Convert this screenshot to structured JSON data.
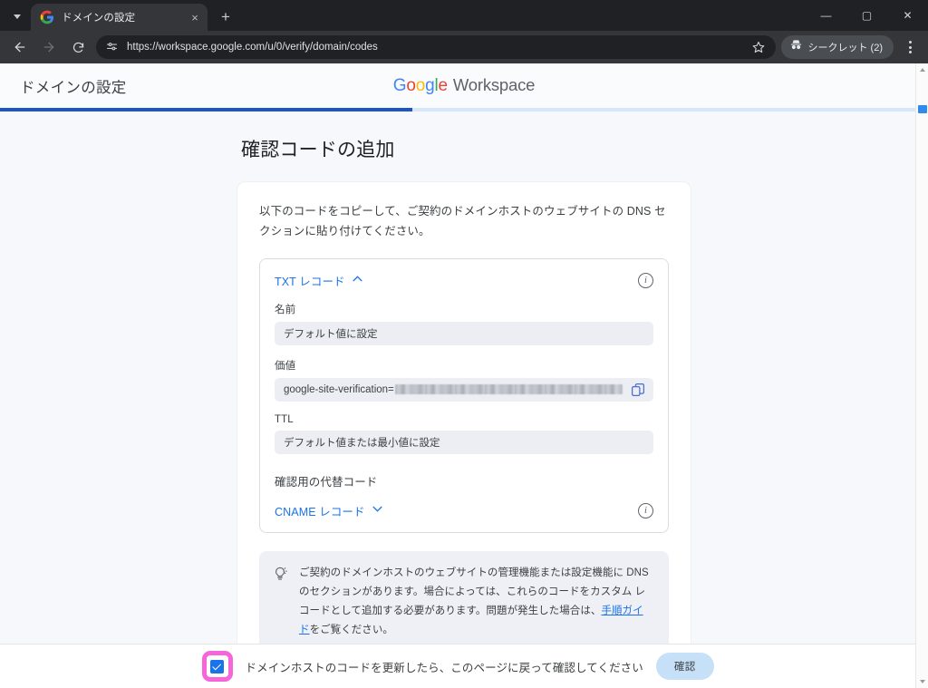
{
  "browser": {
    "tab": {
      "title": "ドメインの設定",
      "favicon": "google-favicon",
      "close_label": "×"
    },
    "tab_search_label": "tab-search",
    "new_tab_label": "+",
    "window_controls": {
      "minimize": "—",
      "maximize": "▢",
      "close": "✕"
    },
    "toolbar": {
      "back_label": "←",
      "forward_label": "→",
      "reload_label": "⟳",
      "url": "https://workspace.google.com/u/0/verify/domain/codes",
      "page_info_icon": "page-settings-icon",
      "bookmark_icon": "star-icon",
      "incognito_label": "シークレット (2)",
      "incognito_icon": "incognito-hat-icon",
      "menu_label": "chrome-menu"
    }
  },
  "page": {
    "header": {
      "title": "ドメインの設定",
      "logo_google": "Google",
      "logo_suffix": "Workspace"
    },
    "progress": {
      "percent": 45
    },
    "heading": "確認コードの追加",
    "instruction": "以下のコードをコピーして、ご契約のドメインホストのウェブサイトの DNS セクションに貼り付けてください。",
    "txt_record": {
      "toggle_label": "TXT レコード",
      "caret": "⌃",
      "info_label": "i",
      "fields": [
        {
          "label": "名前",
          "value": "デフォルト値に設定"
        },
        {
          "label": "価値",
          "value": "google-site-verification=",
          "redacted": true,
          "copy_icon": "copy-icon"
        },
        {
          "label": "TTL",
          "value": "デフォルト値または最小値に設定"
        }
      ]
    },
    "alt_code_heading": "確認用の代替コード",
    "cname_record": {
      "toggle_label": "CNAME レコード",
      "caret": "⌄",
      "info_label": "i"
    },
    "hint": {
      "icon": "lightbulb-icon",
      "text_before": "ご契約のドメインホストのウェブサイトの管理機能または設定機能に DNS のセクションがあります。場合によっては、これらのコードをカスタム レコードとして追加する必要があります。問題が発生した場合は、",
      "link": "手順ガイド",
      "text_after": "をご覧ください。"
    },
    "bottom_bar": {
      "checkbox_checked": true,
      "checkbox_text": "ドメインホストのコードを更新したら、このページに戻って確認してください",
      "verify_button": "確認"
    }
  },
  "colors": {
    "accent_blue": "#1a73e8",
    "progress_fill": "#1a56c4",
    "progress_track": "#d7e6fb",
    "highlight_pink": "#f666d8",
    "verify_button_bg": "#c6e0f7",
    "page_bg": "#f7f8fc"
  }
}
